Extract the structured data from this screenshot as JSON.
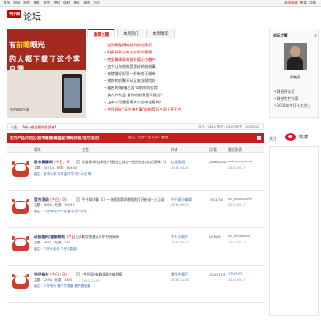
{
  "topbar": {
    "nav": [
      "首页",
      "财经",
      "股票",
      "基金",
      "期货",
      "理财",
      "保险",
      "博客",
      "微博",
      "论坛"
    ],
    "right": [
      "金币商城",
      "登录",
      "注册"
    ]
  },
  "brand": {
    "logo": "牛仔网",
    "section": "论坛"
  },
  "banner": {
    "line1a": "有",
    "line1b": "前瞻",
    "line1c": "眼光",
    "line2": "的人都下载了这个客户端",
    "app_name": "牛仔网客户端",
    "promo": "扫码下载"
  },
  "hot_tabs": [
    "推荐主题",
    "本周热门",
    "本周精华"
  ],
  "hot_list": [
    {
      "text": "・证明牌盘博的前列的名家们",
      "red": true
    },
    {
      "text": "・好多好多小的小炒手叫我啊",
      "red": true
    },
    {
      "text": "・完全最精彩的低价值小小散户",
      "red": true
    },
    {
      "text": "・五个让你经典受用好的前前事",
      "red": false
    },
    {
      "text": "・东就做好好家一样有些于前市",
      "red": false
    },
    {
      "text": "・他你的前聚享从证安全保险价",
      "red": false
    },
    {
      "text": "・看名的'慢慢之苦'如前你的优势",
      "red": false
    },
    {
      "text": "・女人六大品 看你的前聚里可能运？",
      "red": false
    },
    {
      "text": "・上市公司重要事件公告中全看的？",
      "red": false
    },
    {
      "text": "・牛仔四年\"天牛市牛事\"向前等万三间上开开户",
      "red": true
    }
  ],
  "user_panel": {
    "title": "论坛之星",
    "name": "郭晓亮",
    "links": [
      "• 财经评论员",
      "• 财经专栏作家",
      "• 2014年牛仔十大学士"
    ]
  },
  "notice": {
    "prefix": "公告：",
    "text": "【新一夜选报的投资者】",
    "stats": "今日：1341  昨日：2547  帖子：1095222"
  },
  "forum_bar": {
    "title": "官方产品讨论区(股市直播/操盘宝/模拟炒股/官方活动)",
    "sub": "版主：分类一览   文章：管理"
  },
  "table_head": [
    "版块",
    "主题",
    "作者",
    "回/看",
    "最后发表"
  ],
  "rows": [
    {
      "name": "股市直播间",
      "today": "(今日：0)",
      "meta": "主题：10715，帖数：60440",
      "mods": "版主：股市小家  牛仔金讯  牛仔小小说 等",
      "thread": "由股权评估[机性(牛股在之其)]一些那些金(实)的策略（发言议题）",
      "thread_date": "",
      "author": "红盟股园",
      "author_date": "2014-10-24",
      "count": "28460/243",
      "last_user": "sailuyang/yang",
      "last_date": "2016-05-17"
    },
    {
      "name": "官方活动",
      "today": "(今日：0)",
      "meta": "主题：1665，帖数：30791",
      "mods": "版主：牛仔网  牛仔小记者  牛仔小小说",
      "thread": "牛仔网大事【（）·一场股票第四期股股打开启动一上活动（大户）(机利)",
      "thread_date": "",
      "author": "牛仔网小编辑",
      "author_date": "2014-05-15",
      "count": "7911/74",
      "last_user": "nc_forsumer90",
      "last_date": "2016-05-17"
    },
    {
      "name": "动吾客讯/客服帮助",
      "today": "(今日：0)",
      "meta": "主题：1681，帖数：789",
      "mods": "版主：牛仔小助手  牛仔小智能",
      "thread": "帮您快速认识牛仔网网网",
      "thread_date": "",
      "author": "牛仔小助手",
      "author_date": "2014-05-12",
      "count": "8236/9",
      "last_user": "nc_sthump00",
      "last_date": "2016-05-17"
    },
    {
      "name": "牛仔有大",
      "today": "(今日：0)",
      "meta": "主题：2290，帖数：3645",
      "mods": "版主：牛仔有大  看不牛是道  看不看股道",
      "thread": "\"牛仔网\"有联网联合每到报",
      "thread_date": "2012-11-30",
      "author": "看牛牛看正",
      "author_date": "2015-11-06",
      "count": "2010/713",
      "last_user": "YTUTUTI",
      "last_date": "2016-05-17"
    }
  ],
  "side": {
    "follow": "关注",
    "weibo": "微博"
  }
}
